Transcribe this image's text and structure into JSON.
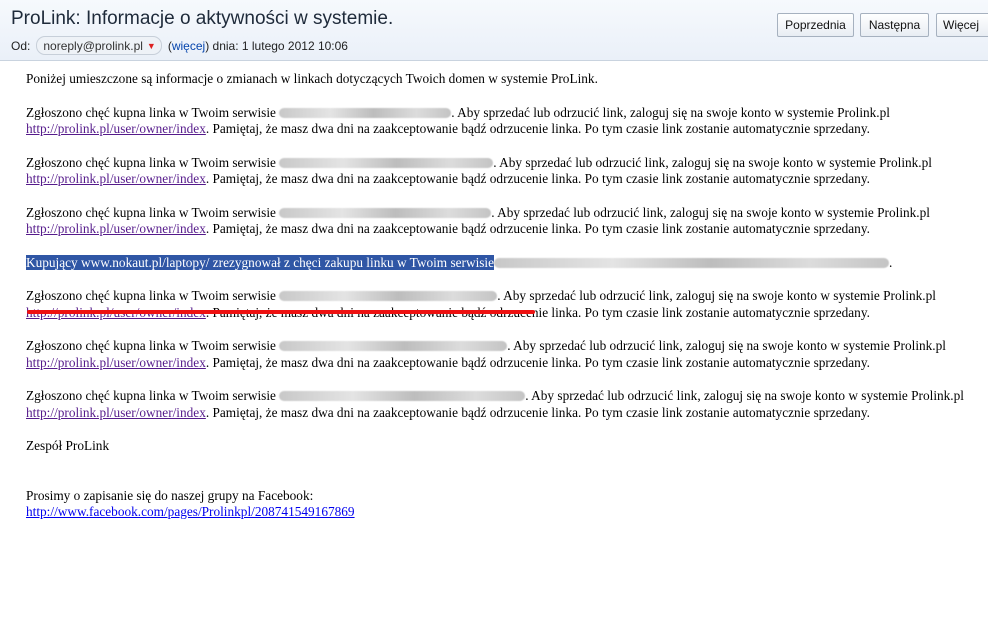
{
  "header": {
    "subject": "ProLink: Informacje o aktywności w systemie.",
    "from_label": "Od:",
    "sender": "noreply@prolink.pl",
    "more_open": "(",
    "more_link": "więcej",
    "more_close": ")",
    "date": "dnia: 1 lutego 2012 10:06",
    "buttons": {
      "prev": "Poprzednia",
      "next": "Następna",
      "more": "Więcej"
    }
  },
  "body": {
    "intro": "Poniżej umieszczone są informacje o zmianach w linkach dotyczących Twoich domen w systemie ProLink.",
    "p1_a": "Zgłoszono chęć kupna linka w Twoim serwisie",
    "p1_b": ". Aby sprzedać lub odrzucić link, zaloguj się na swoje konto w systemie Prolink.pl",
    "p2_a": "Zgłoszono chęć kupna linka w Twoim serwisie",
    "p2_b": ". Aby sprzedać lub odrzucić link, zaloguj się na swoje konto w systemie Prolink.pl",
    "p3_a": "Zgłoszono chęć kupna linka w Twoim serwisie",
    "p3_b": ". Aby sprzedać lub odrzucić link, zaloguj się na swoje konto w systemie Prolink.pl",
    "highlight": "Kupujący www.nokaut.pl/laptopy/ zrezygnował z chęci zakupu linku w Twoim serwisie",
    "highlight_end": ".",
    "p4_a": "Zgłoszono chęć kupna linka w Twoim serwisie",
    "p4_b": ". Aby sprzedać lub odrzucić link, zaloguj się na swoje konto w systemie Prolink.pl",
    "p5_a": "Zgłoszono chęć kupna linka w Twoim serwisie",
    "p5_b": ". Aby sprzedać lub odrzucić link, zaloguj się na swoje konto w systemie Prolink.pl",
    "p6_a": "Zgłoszono chęć kupna linka w Twoim serwisie",
    "p6_b": ". Aby sprzedać lub odrzucić link, zaloguj się na swoje konto w systemie Prolink.pl",
    "link": "http://prolink.pl/user/owner/index",
    "tail": ". Pamiętaj, że masz dwa dni na zaakceptowanie bądź odrzucenie linka. Po tym czasie link zostanie automatycznie sprzedany.",
    "signature": "Zespół ProLink",
    "fb_text": "Prosimy o zapisanie się do naszej grupy na Facebook:",
    "fb_link": "http://www.facebook.com/pages/Prolinkpl/208741549167869"
  },
  "colors": {
    "highlight_bg": "#2f56a5",
    "annotation_red": "#e11111",
    "visited_link": "#551a8b"
  }
}
